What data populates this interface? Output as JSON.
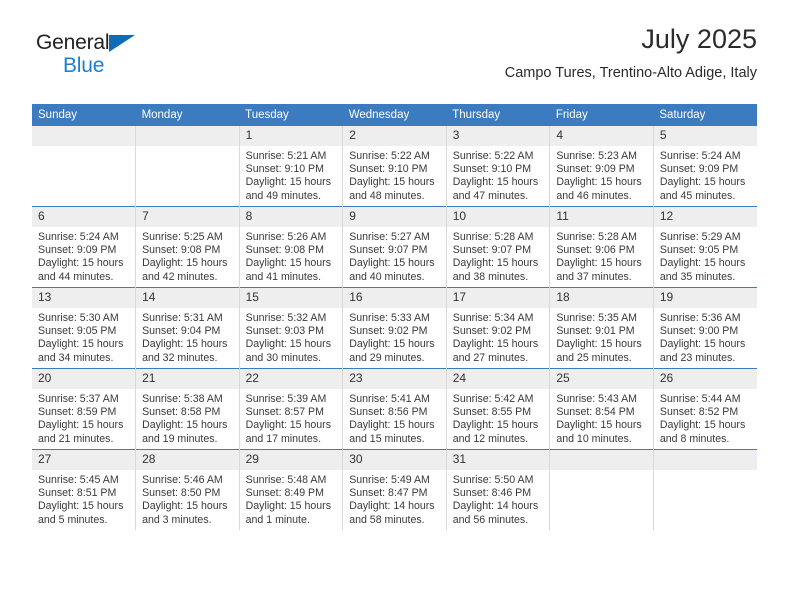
{
  "brand": {
    "name_part1": "General",
    "name_part2": "Blue",
    "logo_icon": "triangle-logo-icon",
    "accent_color": "#1c7fd4"
  },
  "header": {
    "title": "July 2025",
    "subtitle": "Campo Tures, Trentino-Alto Adige, Italy"
  },
  "theme": {
    "header_blue": "#3b7cc0",
    "daynum_gray": "#eeeeee",
    "grid_line": "#d8d8d8"
  },
  "calendar": {
    "weekday_headers": [
      "Sunday",
      "Monday",
      "Tuesday",
      "Wednesday",
      "Thursday",
      "Friday",
      "Saturday"
    ],
    "weeks": [
      [
        {
          "day": "",
          "sunrise": "",
          "sunset": "",
          "daylight": "",
          "empty": true
        },
        {
          "day": "",
          "sunrise": "",
          "sunset": "",
          "daylight": "",
          "empty": true
        },
        {
          "day": "1",
          "sunrise": "Sunrise: 5:21 AM",
          "sunset": "Sunset: 9:10 PM",
          "daylight": "Daylight: 15 hours and 49 minutes."
        },
        {
          "day": "2",
          "sunrise": "Sunrise: 5:22 AM",
          "sunset": "Sunset: 9:10 PM",
          "daylight": "Daylight: 15 hours and 48 minutes."
        },
        {
          "day": "3",
          "sunrise": "Sunrise: 5:22 AM",
          "sunset": "Sunset: 9:10 PM",
          "daylight": "Daylight: 15 hours and 47 minutes."
        },
        {
          "day": "4",
          "sunrise": "Sunrise: 5:23 AM",
          "sunset": "Sunset: 9:09 PM",
          "daylight": "Daylight: 15 hours and 46 minutes."
        },
        {
          "day": "5",
          "sunrise": "Sunrise: 5:24 AM",
          "sunset": "Sunset: 9:09 PM",
          "daylight": "Daylight: 15 hours and 45 minutes."
        }
      ],
      [
        {
          "day": "6",
          "sunrise": "Sunrise: 5:24 AM",
          "sunset": "Sunset: 9:09 PM",
          "daylight": "Daylight: 15 hours and 44 minutes."
        },
        {
          "day": "7",
          "sunrise": "Sunrise: 5:25 AM",
          "sunset": "Sunset: 9:08 PM",
          "daylight": "Daylight: 15 hours and 42 minutes."
        },
        {
          "day": "8",
          "sunrise": "Sunrise: 5:26 AM",
          "sunset": "Sunset: 9:08 PM",
          "daylight": "Daylight: 15 hours and 41 minutes."
        },
        {
          "day": "9",
          "sunrise": "Sunrise: 5:27 AM",
          "sunset": "Sunset: 9:07 PM",
          "daylight": "Daylight: 15 hours and 40 minutes."
        },
        {
          "day": "10",
          "sunrise": "Sunrise: 5:28 AM",
          "sunset": "Sunset: 9:07 PM",
          "daylight": "Daylight: 15 hours and 38 minutes."
        },
        {
          "day": "11",
          "sunrise": "Sunrise: 5:28 AM",
          "sunset": "Sunset: 9:06 PM",
          "daylight": "Daylight: 15 hours and 37 minutes."
        },
        {
          "day": "12",
          "sunrise": "Sunrise: 5:29 AM",
          "sunset": "Sunset: 9:05 PM",
          "daylight": "Daylight: 15 hours and 35 minutes."
        }
      ],
      [
        {
          "day": "13",
          "sunrise": "Sunrise: 5:30 AM",
          "sunset": "Sunset: 9:05 PM",
          "daylight": "Daylight: 15 hours and 34 minutes."
        },
        {
          "day": "14",
          "sunrise": "Sunrise: 5:31 AM",
          "sunset": "Sunset: 9:04 PM",
          "daylight": "Daylight: 15 hours and 32 minutes."
        },
        {
          "day": "15",
          "sunrise": "Sunrise: 5:32 AM",
          "sunset": "Sunset: 9:03 PM",
          "daylight": "Daylight: 15 hours and 30 minutes."
        },
        {
          "day": "16",
          "sunrise": "Sunrise: 5:33 AM",
          "sunset": "Sunset: 9:02 PM",
          "daylight": "Daylight: 15 hours and 29 minutes."
        },
        {
          "day": "17",
          "sunrise": "Sunrise: 5:34 AM",
          "sunset": "Sunset: 9:02 PM",
          "daylight": "Daylight: 15 hours and 27 minutes."
        },
        {
          "day": "18",
          "sunrise": "Sunrise: 5:35 AM",
          "sunset": "Sunset: 9:01 PM",
          "daylight": "Daylight: 15 hours and 25 minutes."
        },
        {
          "day": "19",
          "sunrise": "Sunrise: 5:36 AM",
          "sunset": "Sunset: 9:00 PM",
          "daylight": "Daylight: 15 hours and 23 minutes."
        }
      ],
      [
        {
          "day": "20",
          "sunrise": "Sunrise: 5:37 AM",
          "sunset": "Sunset: 8:59 PM",
          "daylight": "Daylight: 15 hours and 21 minutes."
        },
        {
          "day": "21",
          "sunrise": "Sunrise: 5:38 AM",
          "sunset": "Sunset: 8:58 PM",
          "daylight": "Daylight: 15 hours and 19 minutes."
        },
        {
          "day": "22",
          "sunrise": "Sunrise: 5:39 AM",
          "sunset": "Sunset: 8:57 PM",
          "daylight": "Daylight: 15 hours and 17 minutes."
        },
        {
          "day": "23",
          "sunrise": "Sunrise: 5:41 AM",
          "sunset": "Sunset: 8:56 PM",
          "daylight": "Daylight: 15 hours and 15 minutes."
        },
        {
          "day": "24",
          "sunrise": "Sunrise: 5:42 AM",
          "sunset": "Sunset: 8:55 PM",
          "daylight": "Daylight: 15 hours and 12 minutes."
        },
        {
          "day": "25",
          "sunrise": "Sunrise: 5:43 AM",
          "sunset": "Sunset: 8:54 PM",
          "daylight": "Daylight: 15 hours and 10 minutes."
        },
        {
          "day": "26",
          "sunrise": "Sunrise: 5:44 AM",
          "sunset": "Sunset: 8:52 PM",
          "daylight": "Daylight: 15 hours and 8 minutes."
        }
      ],
      [
        {
          "day": "27",
          "sunrise": "Sunrise: 5:45 AM",
          "sunset": "Sunset: 8:51 PM",
          "daylight": "Daylight: 15 hours and 5 minutes."
        },
        {
          "day": "28",
          "sunrise": "Sunrise: 5:46 AM",
          "sunset": "Sunset: 8:50 PM",
          "daylight": "Daylight: 15 hours and 3 minutes."
        },
        {
          "day": "29",
          "sunrise": "Sunrise: 5:48 AM",
          "sunset": "Sunset: 8:49 PM",
          "daylight": "Daylight: 15 hours and 1 minute."
        },
        {
          "day": "30",
          "sunrise": "Sunrise: 5:49 AM",
          "sunset": "Sunset: 8:47 PM",
          "daylight": "Daylight: 14 hours and 58 minutes."
        },
        {
          "day": "31",
          "sunrise": "Sunrise: 5:50 AM",
          "sunset": "Sunset: 8:46 PM",
          "daylight": "Daylight: 14 hours and 56 minutes."
        },
        {
          "day": "",
          "sunrise": "",
          "sunset": "",
          "daylight": "",
          "empty": true
        },
        {
          "day": "",
          "sunrise": "",
          "sunset": "",
          "daylight": "",
          "empty": true
        }
      ]
    ]
  }
}
